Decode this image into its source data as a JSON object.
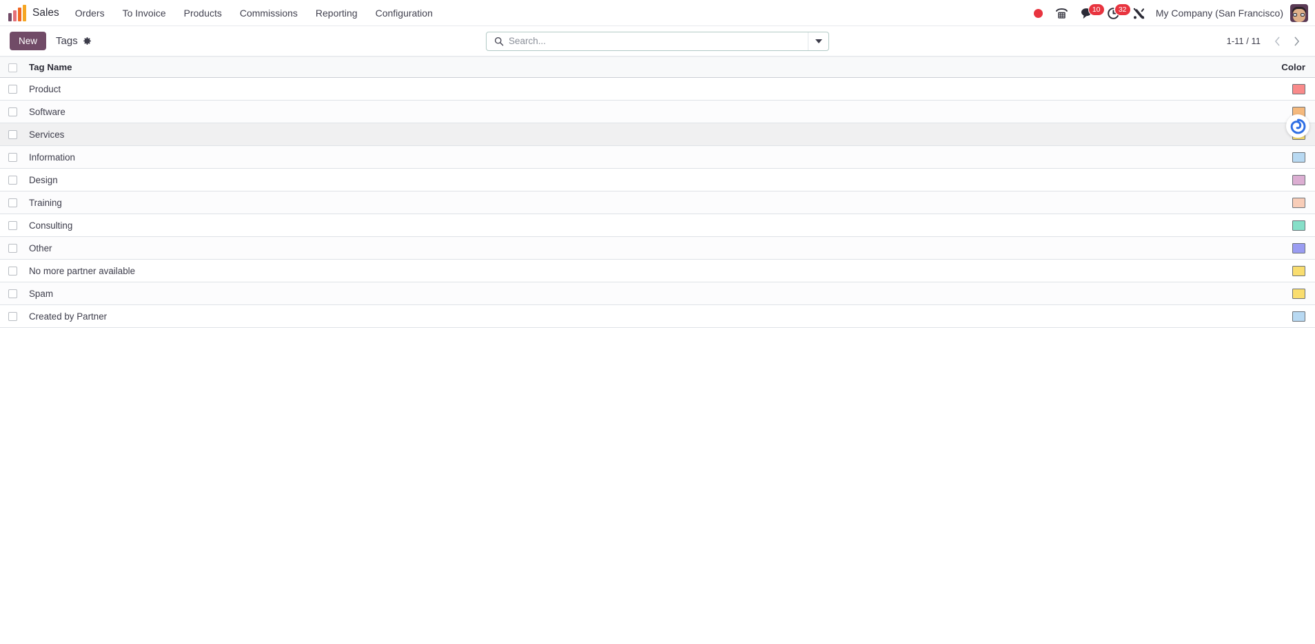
{
  "navbar": {
    "app_name": "Sales",
    "logo_icon": "sales-bars-logo",
    "menus": [
      {
        "label": "Orders"
      },
      {
        "label": "To Invoice"
      },
      {
        "label": "Products"
      },
      {
        "label": "Commissions"
      },
      {
        "label": "Reporting"
      },
      {
        "label": "Configuration"
      }
    ],
    "systray": {
      "presence_icon": "red-dot-icon",
      "dialpad_icon": "dialpad-icon",
      "messages_icon": "chat-bubble-icon",
      "messages_count": "10",
      "activities_icon": "clock-icon",
      "activities_count": "32",
      "debug_icon": "tools-icon",
      "company": "My Company (San Francisco)",
      "avatar_icon": "user-avatar"
    }
  },
  "control_panel": {
    "new_button": "New",
    "breadcrumb_title": "Tags",
    "settings_icon": "gear-icon",
    "search": {
      "placeholder": "Search...",
      "value": "",
      "search_icon": "search-icon",
      "toggle_icon": "chevron-down-icon"
    },
    "pager": {
      "value": "1-11 / 11",
      "previous_icon": "chevron-left-icon",
      "next_icon": "chevron-right-icon"
    }
  },
  "list": {
    "columns": {
      "select_all": "select-all-checkbox",
      "name": "Tag Name",
      "color": "Color"
    },
    "rows": [
      {
        "name": "Product",
        "color": "#f98a8a"
      },
      {
        "name": "Software",
        "color": "#f5b97d"
      },
      {
        "name": "Services",
        "color": "#f9dd6f",
        "hovered": true
      },
      {
        "name": "Information",
        "color": "#b8d9f2"
      },
      {
        "name": "Design",
        "color": "#dcaed2"
      },
      {
        "name": "Training",
        "color": "#f8cdb8"
      },
      {
        "name": "Consulting",
        "color": "#86dfc8"
      },
      {
        "name": "Other",
        "color": "#9a9cf2"
      },
      {
        "name": "No more partner available",
        "color": "#f9dd6f"
      },
      {
        "name": "Spam",
        "color": "#f9dd6f"
      },
      {
        "name": "Created by Partner",
        "color": "#b8d9f2"
      }
    ]
  },
  "widget": {
    "spiral_icon": "spiral-icon",
    "accent_color": "#2f6fe4"
  },
  "theme": {
    "primary": "#714b67",
    "danger": "#e8343f",
    "header_bg": "#f8f9fa"
  }
}
